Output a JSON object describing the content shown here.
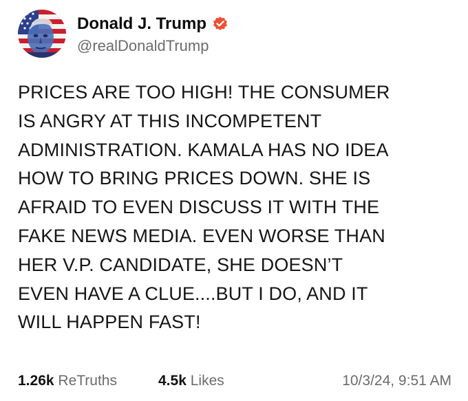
{
  "author": {
    "display_name": "Donald J. Trump",
    "handle": "@realDonaldTrump",
    "verified": true,
    "verified_color": "#f24e32",
    "avatar_icon": "flag-portrait-avatar"
  },
  "post": {
    "text": "PRICES ARE TOO HIGH! THE CONSUMER\nIS ANGRY AT THIS INCOMPETENT\nADMINISTRATION. KAMALA HAS NO IDEA\nHOW TO BRING PRICES DOWN. SHE IS\nAFRAID TO EVEN DISCUSS IT WITH THE\nFAKE NEWS MEDIA. EVEN WORSE THAN\nHER V.P. CANDIDATE, SHE DOESN’T\nEVEN HAVE A CLUE....BUT I DO, AND IT\nWILL HAPPEN FAST!"
  },
  "stats": {
    "retruths_count": "1.26k",
    "retruths_label": "ReTruths",
    "likes_count": "4.5k",
    "likes_label": "Likes"
  },
  "timestamp": "10/3/24, 9:51 AM"
}
